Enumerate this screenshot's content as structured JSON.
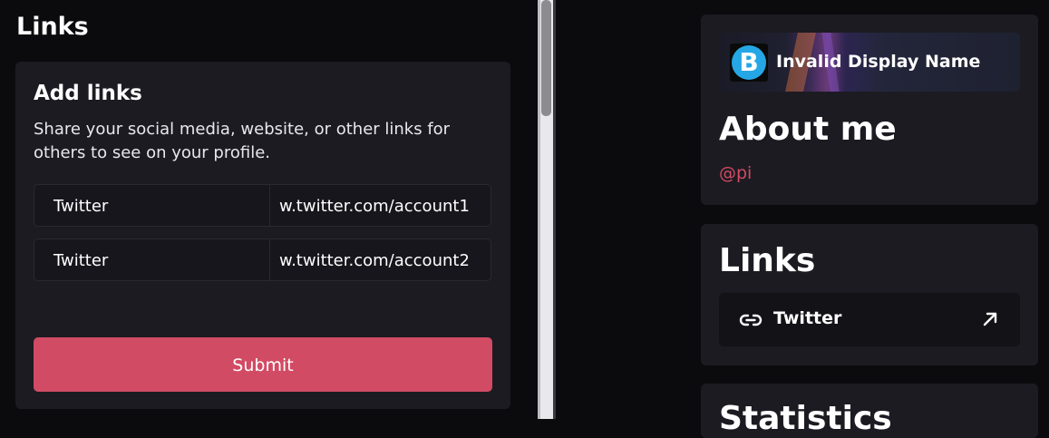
{
  "left": {
    "title": "Links",
    "card": {
      "title": "Add links",
      "description": "Share your social media, website, or other links for others to see on your profile.",
      "rows": [
        {
          "name": "Twitter",
          "url": "w.twitter.com/account1"
        },
        {
          "name": "Twitter",
          "url": "w.twitter.com/account2"
        }
      ],
      "submit_label": "Submit"
    }
  },
  "profile": {
    "avatar_letter": "B",
    "display_name": "Invalid Display Name",
    "about_title": "About me",
    "handle": "@pi"
  },
  "links_panel": {
    "title": "Links",
    "items": [
      {
        "label": "Twitter"
      }
    ]
  },
  "stats_panel": {
    "title": "Statistics"
  },
  "colors": {
    "accent": "#d24b64",
    "panel": "#1c1b22",
    "background": "#0b0b0d",
    "avatar": "#25a7e6"
  }
}
